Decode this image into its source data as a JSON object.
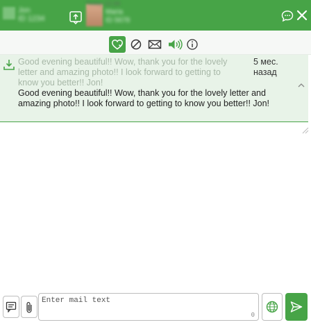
{
  "header": {
    "date_hint": "Today 12:34",
    "sender_name": "Jon",
    "sender_sub": "ID 1234",
    "recipient_name": "Maria",
    "recipient_sub": "ID 5678"
  },
  "toolbar": {
    "icons": [
      "heart-icon",
      "block-icon",
      "mail-icon",
      "sound-icon",
      "info-icon"
    ],
    "active": "heart-icon"
  },
  "message": {
    "preview": "Good evening beautiful!! Wow, thank you for the lovely letter and amazing photo!! I look forward to getting to know you better!! Jon!",
    "time": "5 мес. назад",
    "body": "Good evening beautiful!! Wow, thank you for the lovely letter and amazing photo!! I look forward to getting to know you better!! Jon!"
  },
  "composer": {
    "placeholder": "Enter mail text",
    "char_count": "0"
  },
  "colors": {
    "accent": "#47a447",
    "message_bg": "#e8f3e8"
  }
}
